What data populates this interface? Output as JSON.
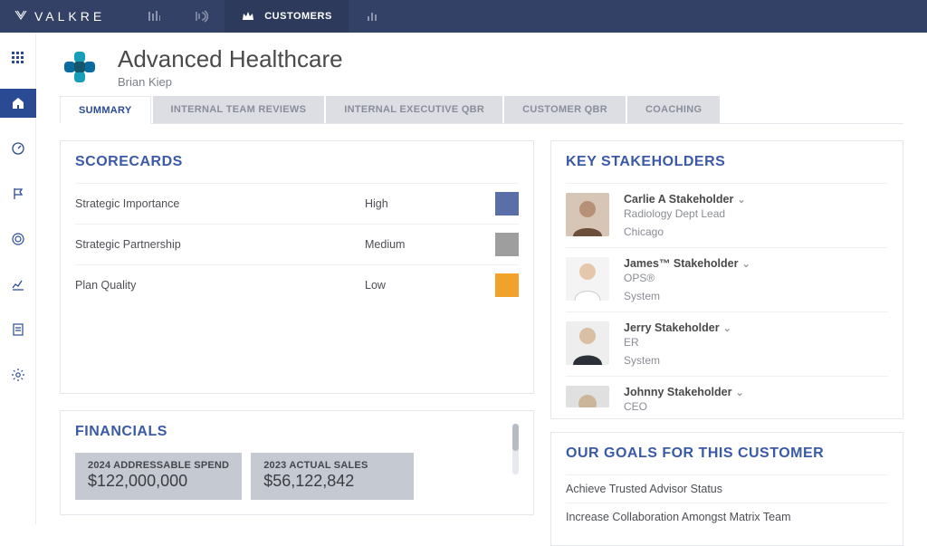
{
  "app": {
    "brand": "VALKRE"
  },
  "topnav": {
    "items": [
      {
        "id": "nav-1",
        "label": ""
      },
      {
        "id": "nav-2",
        "label": ""
      },
      {
        "id": "customers",
        "label": "CUSTOMERS",
        "active": true
      },
      {
        "id": "nav-4",
        "label": ""
      }
    ]
  },
  "customer": {
    "name": "Advanced Healthcare",
    "owner": "Brian Kiep"
  },
  "tabs": [
    {
      "id": "summary",
      "label": "SUMMARY",
      "active": true
    },
    {
      "id": "internal-team",
      "label": "INTERNAL TEAM REVIEWS"
    },
    {
      "id": "internal-exec",
      "label": "INTERNAL EXECUTIVE QBR"
    },
    {
      "id": "customer-qbr",
      "label": "CUSTOMER QBR"
    },
    {
      "id": "coaching",
      "label": "COACHING"
    }
  ],
  "scorecards": {
    "title": "SCORECARDS",
    "rows": [
      {
        "name": "Strategic Importance",
        "value": "High",
        "color": "#5a6ea8"
      },
      {
        "name": "Strategic Partnership",
        "value": "Medium",
        "color": "#9e9e9e"
      },
      {
        "name": "Plan Quality",
        "value": "Low",
        "color": "#f0a22d"
      }
    ]
  },
  "stakeholders": {
    "title": "KEY STAKEHOLDERS",
    "people": [
      {
        "name": "Carlie A Stakeholder",
        "role": "Radiology Dept Lead",
        "location": "Chicago"
      },
      {
        "name": "James™ Stakeholder",
        "role": "OPS®",
        "location": "System"
      },
      {
        "name": "Jerry Stakeholder",
        "role": "ER",
        "location": "System"
      },
      {
        "name": "Johnny Stakeholder",
        "role": "CEO",
        "location": ""
      }
    ]
  },
  "financials": {
    "title": "FINANCIALS",
    "tiles": [
      {
        "label": "2024 ADDRESSABLE SPEND",
        "value": "$122,000,000"
      },
      {
        "label": "2023 ACTUAL SALES",
        "value": "$56,122,842"
      }
    ]
  },
  "goals": {
    "title": "OUR GOALS FOR THIS CUSTOMER",
    "items": [
      "Achieve Trusted Advisor Status",
      "Increase Collaboration Amongst Matrix Team"
    ]
  }
}
